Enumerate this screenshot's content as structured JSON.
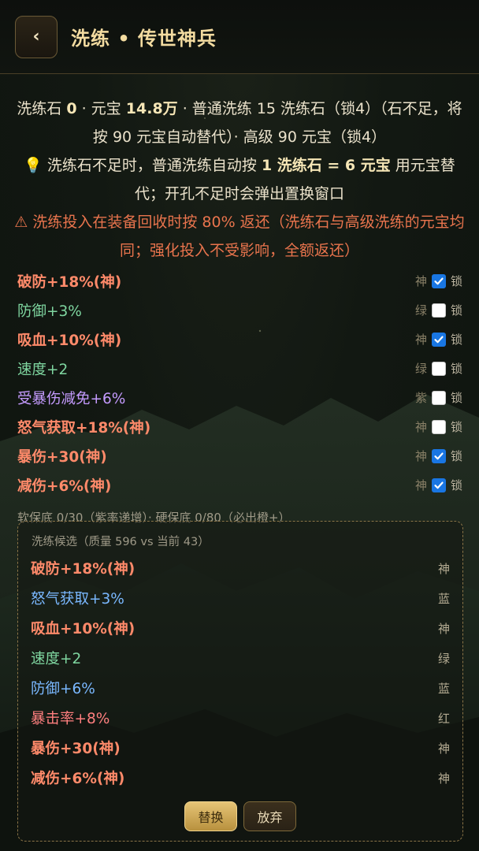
{
  "header": {
    "back_label": "‹",
    "title": "洗练 • 传世神兵"
  },
  "info": {
    "line1_a": "洗练石 ",
    "stone_count": "0",
    "line1_b": " · 元宝 ",
    "yuanbao": "14.8万",
    "line1_c": " · 普通洗练 15 洗练石（锁4）（石不足，将按 90 元宝自动替代）· 高级 90 元宝（锁4）",
    "tip_icon": "💡",
    "tip_a": " 洗练石不足时，普通洗练自动按 ",
    "tip_rate": "1 洗练石 = 6 元宝",
    "tip_b": " 用元宝替代；开孔不足时会弹出置换窗口",
    "warning": "⚠ 洗练投入在装备回收时按 80% 返还（洗练石与高级洗练的元宝均同；强化投入不受影响，全额返还）"
  },
  "current_attrs": [
    {
      "name": "破防+18%(神)",
      "tier": "神",
      "quality": "shen",
      "locked": true
    },
    {
      "name": "防御+3%",
      "tier": "绿",
      "quality": "green",
      "locked": false
    },
    {
      "name": "吸血+10%(神)",
      "tier": "神",
      "quality": "shen",
      "locked": true
    },
    {
      "name": "速度+2",
      "tier": "绿",
      "quality": "green",
      "locked": false
    },
    {
      "name": "受暴伤减免+6%",
      "tier": "紫",
      "quality": "purple",
      "locked": false
    },
    {
      "name": "怒气获取+18%(神)",
      "tier": "神",
      "quality": "shen",
      "locked": false
    },
    {
      "name": "暴伤+30(神)",
      "tier": "神",
      "quality": "shen",
      "locked": true
    },
    {
      "name": "减伤+6%(神)",
      "tier": "神",
      "quality": "shen",
      "locked": true
    }
  ],
  "lock_label": "锁",
  "guarantee": "软保底 0/30（紫率递增）· 硬保底 0/80（必出橙+）",
  "candidate": {
    "header": "洗练候选（质量 596 vs 当前 43）",
    "rows": [
      {
        "name": "破防+18%(神)",
        "tier": "神",
        "quality": "shen"
      },
      {
        "name": "怒气获取+3%",
        "tier": "蓝",
        "quality": "blue"
      },
      {
        "name": "吸血+10%(神)",
        "tier": "神",
        "quality": "shen"
      },
      {
        "name": "速度+2",
        "tier": "绿",
        "quality": "green"
      },
      {
        "name": "防御+6%",
        "tier": "蓝",
        "quality": "blue"
      },
      {
        "name": "暴击率+8%",
        "tier": "红",
        "quality": "red"
      },
      {
        "name": "暴伤+30(神)",
        "tier": "神",
        "quality": "shen"
      },
      {
        "name": "减伤+6%(神)",
        "tier": "神",
        "quality": "shen"
      }
    ],
    "replace_label": "替换",
    "discard_label": "放弃"
  },
  "colors": {
    "shen": "#ff8a6a",
    "green": "#7fd6a0",
    "purple": "#c59bff",
    "blue": "#7ab8ff",
    "red": "#ff7f7f",
    "accent_gold": "#f3dba0",
    "checkbox_on": "#1976e3"
  }
}
